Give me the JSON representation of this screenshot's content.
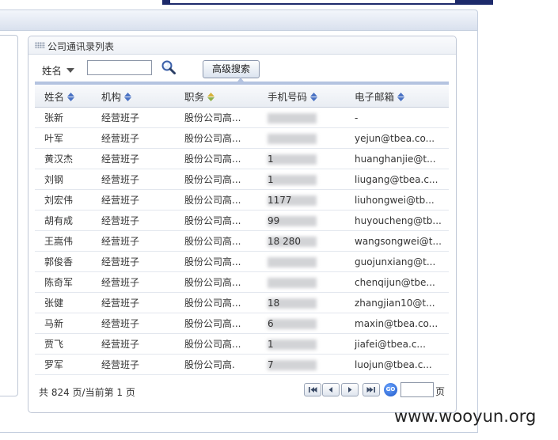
{
  "panel": {
    "title": "公司通讯录列表"
  },
  "search": {
    "field_label": "姓名",
    "input_value": "",
    "advanced_button": "高级搜索"
  },
  "table": {
    "columns": [
      "姓名",
      "机构",
      "职务",
      "手机号码",
      "电子邮箱"
    ],
    "rows": [
      {
        "name": "张新",
        "org": "经营班子",
        "title": "股份公司高...",
        "phone": "",
        "email": "-"
      },
      {
        "name": "叶军",
        "org": "经营班子",
        "title": "股份公司高...",
        "phone": "",
        "email": "yejun@tbea.co..."
      },
      {
        "name": "黄汉杰",
        "org": "经营班子",
        "title": "股份公司高...",
        "phone": "1",
        "email": "huanghanjie@t..."
      },
      {
        "name": "刘钢",
        "org": "经营班子",
        "title": "股份公司高...",
        "phone": "1",
        "email": "liugang@tbea.c..."
      },
      {
        "name": "刘宏伟",
        "org": "经营班子",
        "title": "股份公司高...",
        "phone": "1177",
        "email": "liuhongwei@tb..."
      },
      {
        "name": "胡有成",
        "org": "经营班子",
        "title": "股份公司高...",
        "phone": "99",
        "email": "huyoucheng@tb..."
      },
      {
        "name": "王嵩伟",
        "org": "经营班子",
        "title": "股份公司高...",
        "phone": "18 280",
        "email": "wangsongwei@t..."
      },
      {
        "name": "郭俊香",
        "org": "经营班子",
        "title": "股份公司高...",
        "phone": "",
        "email": "guojunxiang@t..."
      },
      {
        "name": "陈奇军",
        "org": "经营班子",
        "title": "股份公司高...",
        "phone": "",
        "email": "chenqijun@tbe..."
      },
      {
        "name": "张健",
        "org": "经营班子",
        "title": "股份公司高...",
        "phone": "18",
        "email": "zhangjian10@t..."
      },
      {
        "name": "马新",
        "org": "经营班子",
        "title": "股份公司高...",
        "phone": "6",
        "email": "maxin@tbea.co..."
      },
      {
        "name": "贾飞",
        "org": "经营班子",
        "title": "股份公司高...",
        "phone": "1",
        "email": "jiafei@tbea.c..."
      },
      {
        "name": "罗军",
        "org": "经营班子",
        "title": "股份公司高.",
        "phone": "7",
        "email": "luojun@tbea.c..."
      }
    ]
  },
  "pager": {
    "summary": "共 824 页/当前第 1 页",
    "go_label": "GO",
    "page_unit": "页",
    "page_input": ""
  },
  "watermark": "www.wooyun.org",
  "colors": {
    "header_bar": "#1d2a6b",
    "accent": "#b4c3e0",
    "sort_icon": "#4a72c4",
    "sort_icon_active": "#d6b23a"
  },
  "icons": {
    "search": "magnifier-icon",
    "sort": "sort-arrows-icon",
    "pager_first": "first-page-icon",
    "pager_prev": "prev-page-icon",
    "pager_next": "next-page-icon",
    "pager_last": "last-page-icon",
    "go": "go-icon"
  }
}
